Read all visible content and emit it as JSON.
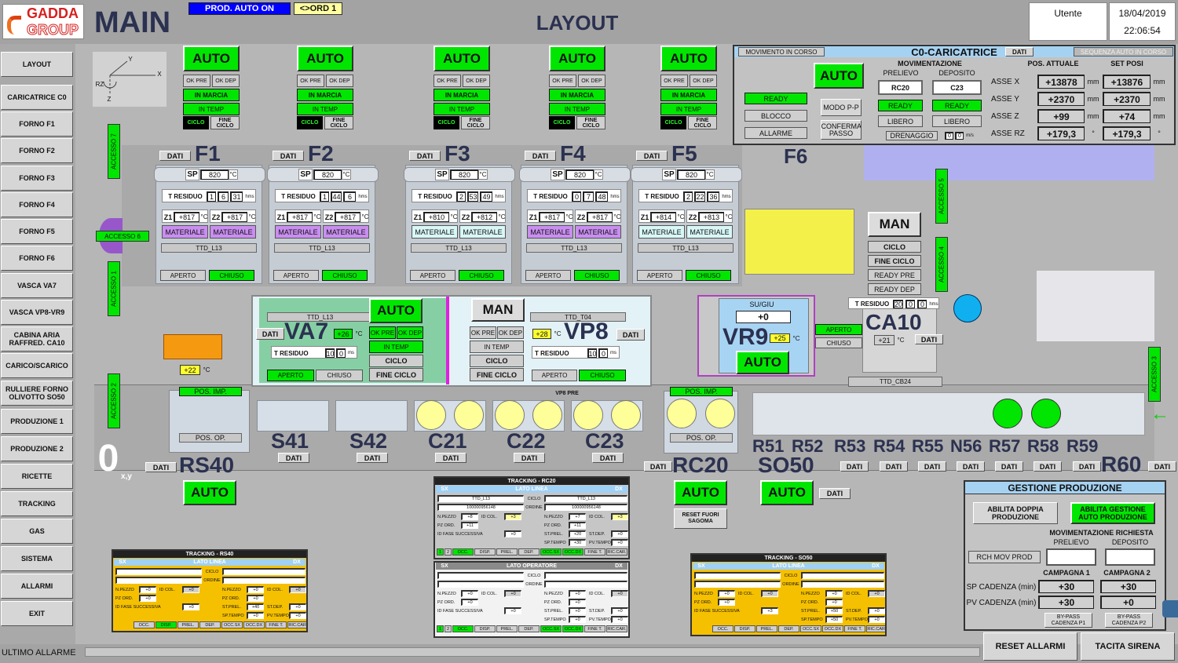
{
  "header": {
    "logo_top": "GADDA",
    "logo_bottom": "GROUP",
    "title": "MAIN",
    "prod_status": "PROD. AUTO ON",
    "ord": "<>ORD 1",
    "page": "LAYOUT",
    "user_label": "Utente",
    "date": "18/04/2019",
    "time": "22:06:54"
  },
  "colors": {
    "green": "#00e600",
    "brand_red": "#d62020",
    "prod_blue": "#0000ff",
    "tracking_yellow": "#f5c000",
    "panel_blue": "#9fd0f5"
  },
  "sidebar": [
    "LAYOUT",
    "CARICATRICE C0",
    "FORNO F1",
    "FORNO F2",
    "FORNO F3",
    "FORNO F4",
    "FORNO F5",
    "FORNO F6",
    "VASCA VA7",
    "VASCA VP8-VR9",
    "CABINA ARIA RAFFRED. CA10",
    "CARICO/SCARICO",
    "RULLIERE FORNO OLIVOTTO SO50",
    "PRODUZIONE 1",
    "PRODUZIONE 2",
    "RICETTE",
    "TRACKING",
    "GAS",
    "SISTEMA",
    "ALLARMI",
    "EXIT"
  ],
  "axes": {
    "x": "X",
    "y": "Y",
    "z": "Z",
    "rz": "RZ"
  },
  "lbl": {
    "auto": "AUTO",
    "man": "MAN",
    "ok_pre": "OK PRE",
    "ok_dep": "OK DEP",
    "in_marcia": "IN MARCIA",
    "in_temp": "IN TEMP",
    "ciclo": "CICLO",
    "fine_ciclo": "FINE CICLO",
    "dati": "DATI",
    "sp": "SP",
    "degc": "°C",
    "deg": "°",
    "t_residuo": "T RESIDUO",
    "hms": "hms",
    "ms": "ms",
    "z1": "Z1",
    "z2": "Z2",
    "aperto": "APERTO",
    "chiuso": "CHIUSO",
    "pos_imp": "POS. IMP.",
    "pos_op": "POS. OP.",
    "mm": "mm",
    "ready_pre": "READY PRE",
    "ready_dep": "READY DEP",
    "su_giu": "SU/GIU",
    "vp8_pre": "VP8 PRE",
    "reset_fuori_sagoma": "RESET FUORI SAGOMA",
    "origin": "0",
    "origin_sub": "x,y"
  },
  "furnaces": [
    {
      "name": "F1",
      "sp": "820",
      "t_res": [
        "1",
        "6",
        "31"
      ],
      "z1": "+817",
      "z2": "+817",
      "mat": [
        "MATERIALE",
        "MATERIALE"
      ],
      "mat_color": "purple",
      "ttd": "TTD_L13"
    },
    {
      "name": "F2",
      "sp": "820",
      "t_res": [
        "1",
        "44",
        "6"
      ],
      "z1": "+817",
      "z2": "+817",
      "mat": [
        "MATERIALE",
        "MATERIALE"
      ],
      "mat_color": "purple",
      "ttd": "TTD_L13"
    },
    {
      "name": "F3",
      "sp": "820",
      "t_res": [
        "2",
        "53",
        "49"
      ],
      "z1": "+810",
      "z2": "+812",
      "mat": [
        "MATERIALE",
        "MATERIALE"
      ],
      "mat_color": "cyan",
      "ttd": "TTD_L13"
    },
    {
      "name": "F4",
      "sp": "820",
      "t_res": [
        "0",
        "7",
        "48"
      ],
      "z1": "+817",
      "z2": "+817",
      "mat": [
        "MATERIALE",
        "MATERIALE"
      ],
      "mat_color": "purple",
      "ttd": "TTD_L13"
    },
    {
      "name": "F5",
      "sp": "820",
      "t_res": [
        "2",
        "22",
        "36"
      ],
      "z1": "+814",
      "z2": "+813",
      "mat": [
        "MATERIALE",
        "MATERIALE"
      ],
      "mat_color": "cyan",
      "ttd": "TTD_L13"
    }
  ],
  "f6": {
    "name": "F6"
  },
  "accessi": [
    "ACCESSO 7",
    "ACCESSO 6",
    "ACCESSO 1",
    "ACCESSO 2",
    "ACCESSO 5",
    "ACCESSO 4",
    "ACCESSO 3"
  ],
  "c0": {
    "movimento": "MOVIMENTO IN CORSO",
    "title": "C0-CARICATRICE",
    "sequenza": "SEQUENZA AUTO IN CORSO",
    "ready": "READY",
    "blocco": "BLOCCO",
    "allarme": "ALLARME",
    "modo": "MODO P-P",
    "conferma": "CONFERMA PASSO",
    "movimentazione": "MOVIMENTAZIONE",
    "prelievo": "PRELIEVO",
    "deposito": "DEPOSITO",
    "prelievo_val": "RC20",
    "deposito_val": "C23",
    "libero": "LIBERO",
    "drenaggio": "DRENAGGIO",
    "dren_vals": [
      "0",
      "0"
    ],
    "dren_unit": "m/s",
    "pos_attuale": "POS. ATTUALE",
    "set_posi": "SET POSI",
    "assi": [
      {
        "name": "ASSE X",
        "pos": "+13878",
        "set": "+13876",
        "unit": "mm"
      },
      {
        "name": "ASSE Y",
        "pos": "+2370",
        "set": "+2370",
        "unit": "mm"
      },
      {
        "name": "ASSE Z",
        "pos": "+99",
        "set": "+74",
        "unit": "mm"
      },
      {
        "name": "ASSE RZ",
        "pos": "+179,3",
        "set": "+179,3",
        "unit": "°"
      }
    ]
  },
  "va7": {
    "name": "VA7",
    "ttd": "TTD_L13",
    "temp": "+26",
    "t_res": [
      "10",
      "0"
    ]
  },
  "vp8": {
    "name": "VP8",
    "ttd": "TTD_T04",
    "temp": "+28",
    "t_res": [
      "10",
      "0"
    ]
  },
  "vr9": {
    "name": "VR9",
    "su_giu": "+0",
    "temp": "+25"
  },
  "ca10": {
    "name": "CA10",
    "t_res": [
      "20",
      "0",
      "0"
    ],
    "temp": "+21",
    "ttd": "TTD_CB24"
  },
  "rs40": {
    "name": "RS40",
    "temp": "+22"
  },
  "stations": [
    "S41",
    "S42",
    "C21",
    "C22",
    "C23"
  ],
  "rc20": {
    "name": "RC20"
  },
  "so50": {
    "name": "SO50"
  },
  "rulliere": [
    "R51",
    "R52",
    "R53",
    "R54",
    "R55",
    "N56",
    "R57",
    "R58",
    "R59"
  ],
  "r60": {
    "name": "R60"
  },
  "trk_labels": {
    "sx": "SX",
    "dx": "DX",
    "lato_linea": "LATO LINEA",
    "lato_operatore": "LATO OPERATORE",
    "ciclo": "CICLO",
    "ordine": "ORDINE",
    "npezzo": "N.PEZZO",
    "idcol": "ID COL.",
    "pzord": "PZ ORD.",
    "idfase": "ID FASE SUCCESSIVA",
    "stprel": "ST.PREL.",
    "stdep": "ST.DEP.",
    "sptempo": "SP.TEMPO",
    "pvtempo": "PV.TEMPO",
    "status": [
      "1",
      "2",
      "OCC.",
      "DISP.",
      "PREL.",
      "DEP.",
      "OCC.SX",
      "OCC.DX",
      "FINE T.",
      "RIC.CAR."
    ]
  },
  "tracking": [
    {
      "title": "TRACKING - RS40",
      "side": "lato_linea",
      "ciclo_sx": "",
      "ciclo_dx": "",
      "ordine_sx": "",
      "ordine_dx": "",
      "npezzo_sx": "+0",
      "idcol_sx": "+0",
      "pzord_sx": "+0",
      "idfase": "+0",
      "npezzo_dx": "+0",
      "idcol_dx": "+0",
      "pzord_dx": "+0",
      "stprel": "+40",
      "stdep": "+0",
      "sptempo": "+0",
      "pvtempo": "+0",
      "active": [
        "DISP."
      ],
      "has_12": false
    },
    {
      "title": "TRACKING - RC20",
      "side": "lato_linea",
      "ciclo_sx": "TTD_L13",
      "ciclo_dx": "TTD_L13",
      "ordine_sx": "100000956148",
      "ordine_dx": "100000956148",
      "npezzo_sx": "+8",
      "idcol_sx": "+3",
      "pzord_sx": "+11",
      "idfase": "+0",
      "npezzo_dx": "+7",
      "idcol_dx": "+3",
      "pzord_dx": "+11",
      "stprel": "+20",
      "stdep": "+0",
      "sptempo": "+30",
      "pvtempo": "+0",
      "active": [
        "1",
        "OCC.",
        "OCC.SX",
        "OCC.DX"
      ],
      "has_12": true
    },
    {
      "title": "",
      "side": "lato_operatore",
      "ciclo_sx": "",
      "ciclo_dx": "",
      "ordine_sx": "",
      "ordine_dx": "",
      "npezzo_sx": "+0",
      "idcol_sx": "+0",
      "pzord_sx": "+0",
      "idfase": "+0",
      "npezzo_dx": "+0",
      "idcol_dx": "+0",
      "pzord_dx": "+0",
      "stprel": "+0",
      "stdep": "+0",
      "sptempo": "+0",
      "pvtempo": "+0",
      "active": [
        "1",
        "OCC.",
        "OCC.SX",
        "OCC.DX"
      ],
      "has_12": true
    },
    {
      "title": "TRACKING - SO50",
      "side": "lato_linea",
      "ciclo_sx": "",
      "ciclo_dx": "",
      "ordine_sx": "",
      "ordine_dx": "",
      "npezzo_sx": "+0",
      "idcol_sx": "+0",
      "pzord_sx": "+0",
      "idfase": "+3",
      "npezzo_dx": "+0",
      "idcol_dx": "+0",
      "pzord_dx": "+0",
      "stprel": "+50",
      "stdep": "+0",
      "sptempo": "+50",
      "pvtempo": "+0",
      "active": [],
      "has_12": false
    }
  ],
  "gestione": {
    "title": "GESTIONE PRODUZIONE",
    "doppia": "ABILITA DOPPIA PRODUZIONE",
    "auto_prod": "ABILITA GESTIONE AUTO PRODUZIONE",
    "mov_richiesta": "MOVIMENTAZIONE RICHIESTA",
    "prelievo": "PRELIEVO",
    "deposito": "DEPOSITO",
    "rch": "RCH MOV PROD",
    "prelievo_val": "",
    "deposito_val": "",
    "campagna1": "CAMPAGNA 1",
    "campagna2": "CAMPAGNA 2",
    "sp_cadenza": "SP CADENZA (min)",
    "pv_cadenza": "PV CADENZA (min)",
    "sp_vals": [
      "+30",
      "+30"
    ],
    "pv_vals": [
      "+30",
      "+0"
    ],
    "bypass1": "BY-PASS CADENZA P1",
    "bypass2": "BY-PASS CADENZA P2"
  },
  "footer": {
    "ultimo_allarme": "ULTIMO ALLARME",
    "allarme_text": "",
    "reset": "RESET ALLARMI",
    "tacita": "TACITA SIRENA"
  }
}
